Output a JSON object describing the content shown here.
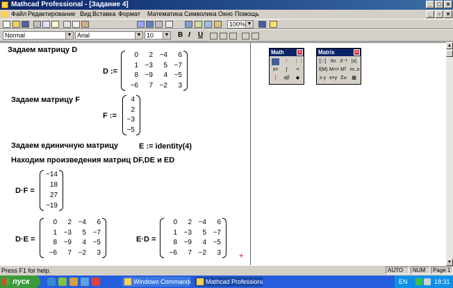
{
  "window": {
    "title": "Mathcad Professional - [Задание 4]"
  },
  "menu": [
    "Файл",
    "Редактирование",
    "Вид",
    "Вставка",
    "Формат",
    "Математика",
    "Символика",
    "Окно",
    "Помощь"
  ],
  "toolbar": {
    "zoom": "100%"
  },
  "format_toolbar": {
    "style": "Normal",
    "font": "Arial",
    "size": "10",
    "bold": "B",
    "italic": "I",
    "underline": "U"
  },
  "worksheet": {
    "h1": "Задаем матрицу D",
    "d_lhs": "D :=",
    "D": [
      [
        "0",
        "2",
        "−4",
        "6"
      ],
      [
        "1",
        "−3",
        "5",
        "−7"
      ],
      [
        "8",
        "−9",
        "4",
        "−5"
      ],
      [
        "−6",
        "7",
        "−2",
        "3"
      ]
    ],
    "h2": "Задаем матрицу F",
    "f_lhs": "F :=",
    "F": [
      [
        "4"
      ],
      [
        "2"
      ],
      [
        "−3"
      ],
      [
        "−5"
      ]
    ],
    "h3": "Задаем единичную матрицу",
    "e_def": "E := identity(4)",
    "h4": "Находим произведения матриц DF,DE и ED",
    "df_lhs": "D·F =",
    "DF": [
      [
        "−14"
      ],
      [
        "18"
      ],
      [
        "27"
      ],
      [
        "−19"
      ]
    ],
    "de_lhs": "D·E =",
    "DE": [
      [
        "0",
        "2",
        "−4",
        "6"
      ],
      [
        "1",
        "−3",
        "5",
        "−7"
      ],
      [
        "8",
        "−9",
        "4",
        "−5"
      ],
      [
        "−6",
        "7",
        "−2",
        "3"
      ]
    ],
    "ed_lhs": "E·D =",
    "ED": [
      [
        "0",
        "2",
        "−4",
        "6"
      ],
      [
        "1",
        "−3",
        "5",
        "−7"
      ],
      [
        "8",
        "−9",
        "4",
        "−5"
      ],
      [
        "−6",
        "7",
        "−2",
        "3"
      ]
    ],
    "cursor": "+"
  },
  "palettes": {
    "math_title": "Math",
    "matrix_title": "Matrix"
  },
  "status": {
    "help": "Press F1 for help.",
    "mode": "AUTO",
    "num": "NUM",
    "page": "Page 1"
  },
  "taskbar": {
    "start": "пуск",
    "tasks": [
      "Windows Commander...",
      "Mathcad Professional..."
    ],
    "lang": "EN",
    "clock": "18:31"
  }
}
